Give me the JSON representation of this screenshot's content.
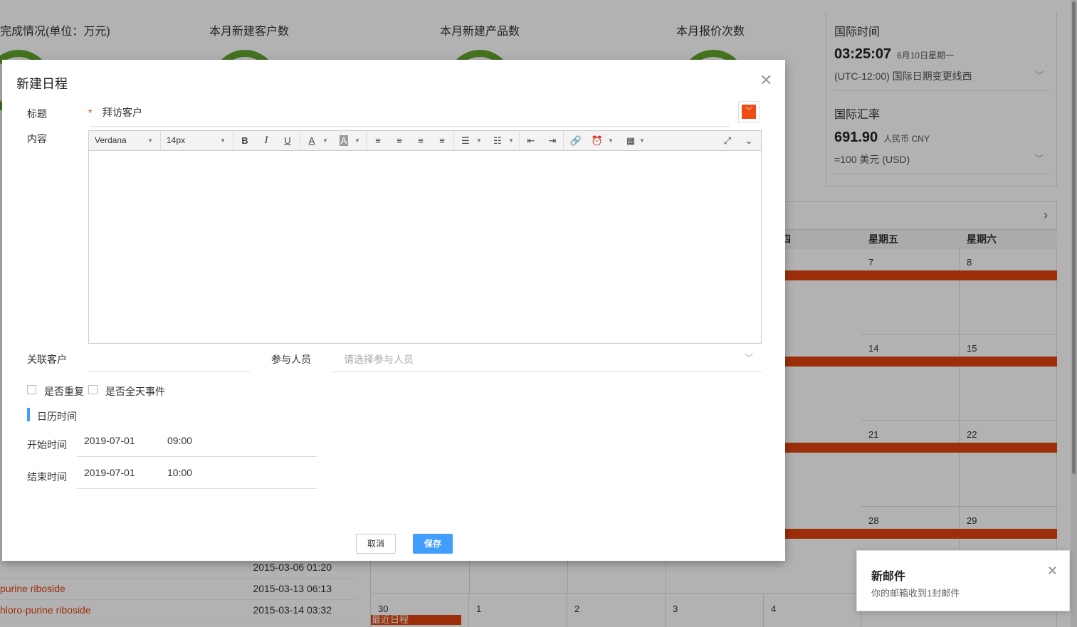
{
  "background": {
    "stats": [
      {
        "title": "完成情况(单位：万元)"
      },
      {
        "title": "本月新建客户数"
      },
      {
        "title": "本月新建产品数"
      },
      {
        "title": "本月报价次数"
      }
    ],
    "world_time": {
      "title": "国际时间",
      "time": "03:25:07",
      "date": "6月10日星期一",
      "zone": "(UTC-12:00) 国际日期变更线西"
    },
    "exchange": {
      "title": "国际汇率",
      "value": "691.90",
      "currency": "人民币 CNY",
      "base": "=100 美元 (USD)"
    },
    "calendar": {
      "next_label": "›",
      "weekdays": [
        "期四",
        "星期五",
        "星期六"
      ],
      "rows": [
        [
          "",
          "7",
          "8"
        ],
        [
          "",
          "14",
          "15"
        ],
        [
          "",
          "21",
          "22"
        ],
        [
          "",
          "28",
          "29"
        ]
      ],
      "last_row": [
        "30",
        "1",
        "2",
        "3",
        "4"
      ],
      "event_label": "最近日程"
    },
    "list": [
      {
        "name": "",
        "date": "2015-03-06 01:20"
      },
      {
        "name": "purine riboside",
        "date": "2015-03-13 06:13"
      },
      {
        "name": "hloro-purine riboside",
        "date": "2015-03-14 03:32"
      }
    ],
    "mail": {
      "title": "新邮件",
      "text": "你的邮箱收到1封邮件",
      "close": "✕"
    }
  },
  "modal": {
    "title": "新建日程",
    "close": "✕",
    "fields": {
      "title_label": "标题",
      "required_mark": "*",
      "title_value": "拜访客户",
      "content_label": "内容",
      "customer_label": "关联客户",
      "participants_label": "参与人员",
      "participants_placeholder": "请选择参与人员",
      "repeat_label": "是否重复",
      "allday_label": "是否全天事件",
      "section_label": "日历时间",
      "start_label": "开始时间",
      "start_date": "2019-07-01",
      "start_time": "09:00",
      "end_label": "结束时间",
      "end_date": "2019-07-01",
      "end_time": "10:00"
    },
    "editor": {
      "font": "Verdana",
      "size": "14px"
    },
    "buttons": {
      "cancel": "取消",
      "save": "保存"
    }
  },
  "colors": {
    "accent": "#409eff",
    "event": "#e0440e",
    "gauge": "#62a52f"
  }
}
